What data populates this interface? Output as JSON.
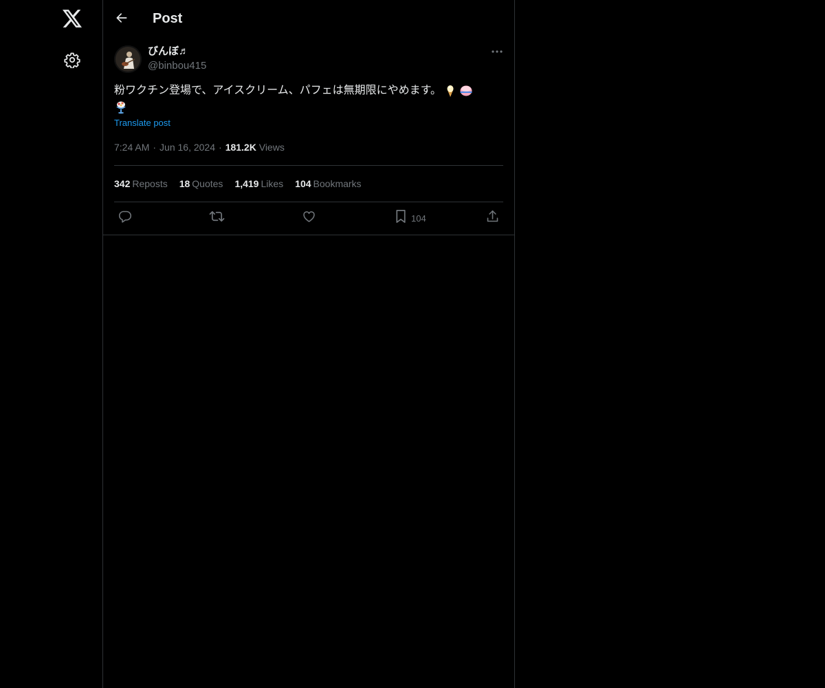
{
  "header": {
    "title": "Post"
  },
  "nav": {
    "logo_icon": "x-logo-icon",
    "settings_icon": "gear-icon"
  },
  "post": {
    "display_name": "びんぼ♬",
    "handle": "@binbou415",
    "text": "粉ワクチン登場で、アイスクリーム、パフェは無期限にやめます。",
    "emojis": [
      "ice-cream-cone-emoji",
      "shaved-ice-emoji",
      "ice-cream-parfait-emoji"
    ],
    "translate_label": "Translate post",
    "time": "7:24 AM",
    "date": "Jun 16, 2024",
    "views_count": "181.2K",
    "views_label": "Views"
  },
  "stats": {
    "reposts_count": "342",
    "reposts_label": "Reposts",
    "quotes_count": "18",
    "quotes_label": "Quotes",
    "likes_count": "1,419",
    "likes_label": "Likes",
    "bookmarks_count": "104",
    "bookmarks_label": "Bookmarks"
  },
  "actions": {
    "bookmark_count": "104"
  },
  "colors": {
    "background": "#000000",
    "text_primary": "#e7e9ea",
    "text_secondary": "#71767b",
    "link": "#1d9bf0",
    "border": "#2f3336"
  }
}
